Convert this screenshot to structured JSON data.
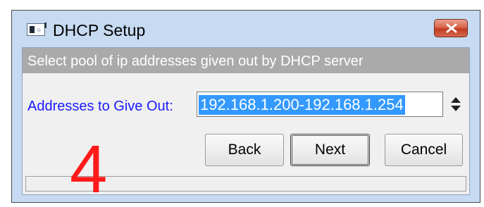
{
  "window": {
    "title": "DHCP Setup",
    "icons": {
      "app": "winbox-app-icon",
      "close": "close-icon"
    }
  },
  "banner": {
    "text": "Select pool of ip addresses given out by DHCP server"
  },
  "form": {
    "addresses_label": "Addresses to Give Out:",
    "addresses_value": "192.168.1.200-192.168.1.254",
    "spinner_icon": "up-down-arrows-icon"
  },
  "buttons": {
    "back": "Back",
    "next": "Next",
    "cancel": "Cancel"
  },
  "annotation": {
    "step_number": "4"
  },
  "colors": {
    "label": "#1a1aff",
    "selection": "#3399ff",
    "banner": "#aaaaaa",
    "annotation": "#ff1a1a",
    "close_button": "#c23a20"
  }
}
